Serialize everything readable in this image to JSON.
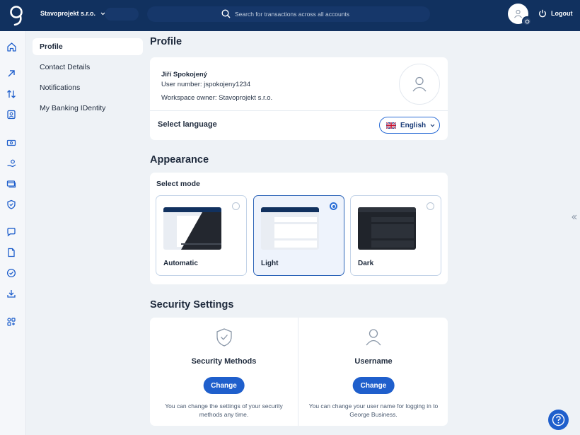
{
  "topbar": {
    "account_name": "Stavoprojekt s.r.o.",
    "search_placeholder": "Search for transactions across all accounts",
    "logout_label": "Logout"
  },
  "submenu": {
    "items": [
      {
        "label": "Profile",
        "active": true
      },
      {
        "label": "Contact Details",
        "active": false
      },
      {
        "label": "Notifications",
        "active": false
      },
      {
        "label": "My Banking IDentity",
        "active": false
      }
    ]
  },
  "profile": {
    "title": "Profile",
    "name": "Jiří Spokojený",
    "user_number": "User number: jspokojeny1234",
    "workspace_owner": "Workspace owner: Stavoprojekt s.r.o.",
    "select_language_label": "Select language",
    "language_value": "English"
  },
  "appearance": {
    "title": "Appearance",
    "select_mode_label": "Select mode",
    "modes": [
      {
        "label": "Automatic",
        "selected": false
      },
      {
        "label": "Light",
        "selected": true
      },
      {
        "label": "Dark",
        "selected": false
      }
    ]
  },
  "security": {
    "title": "Security Settings",
    "methods": {
      "title": "Security Methods",
      "button": "Change",
      "description": "You can change the settings of your security methods any time."
    },
    "username": {
      "title": "Username",
      "button": "Change",
      "description": "You can change your user name for logging in to George Business."
    }
  },
  "colors": {
    "topbar": "#11315f",
    "accent": "#1f5fcc",
    "background": "#eef2f6"
  },
  "icons": [
    "home-icon",
    "arrow-up-right-icon",
    "transfer-arrows-icon",
    "contact-card-icon",
    "banknote-icon",
    "hand-coin-icon",
    "cards-icon",
    "shield-icon",
    "chat-icon",
    "document-icon",
    "check-circle-icon",
    "download-icon",
    "apps-icon"
  ]
}
